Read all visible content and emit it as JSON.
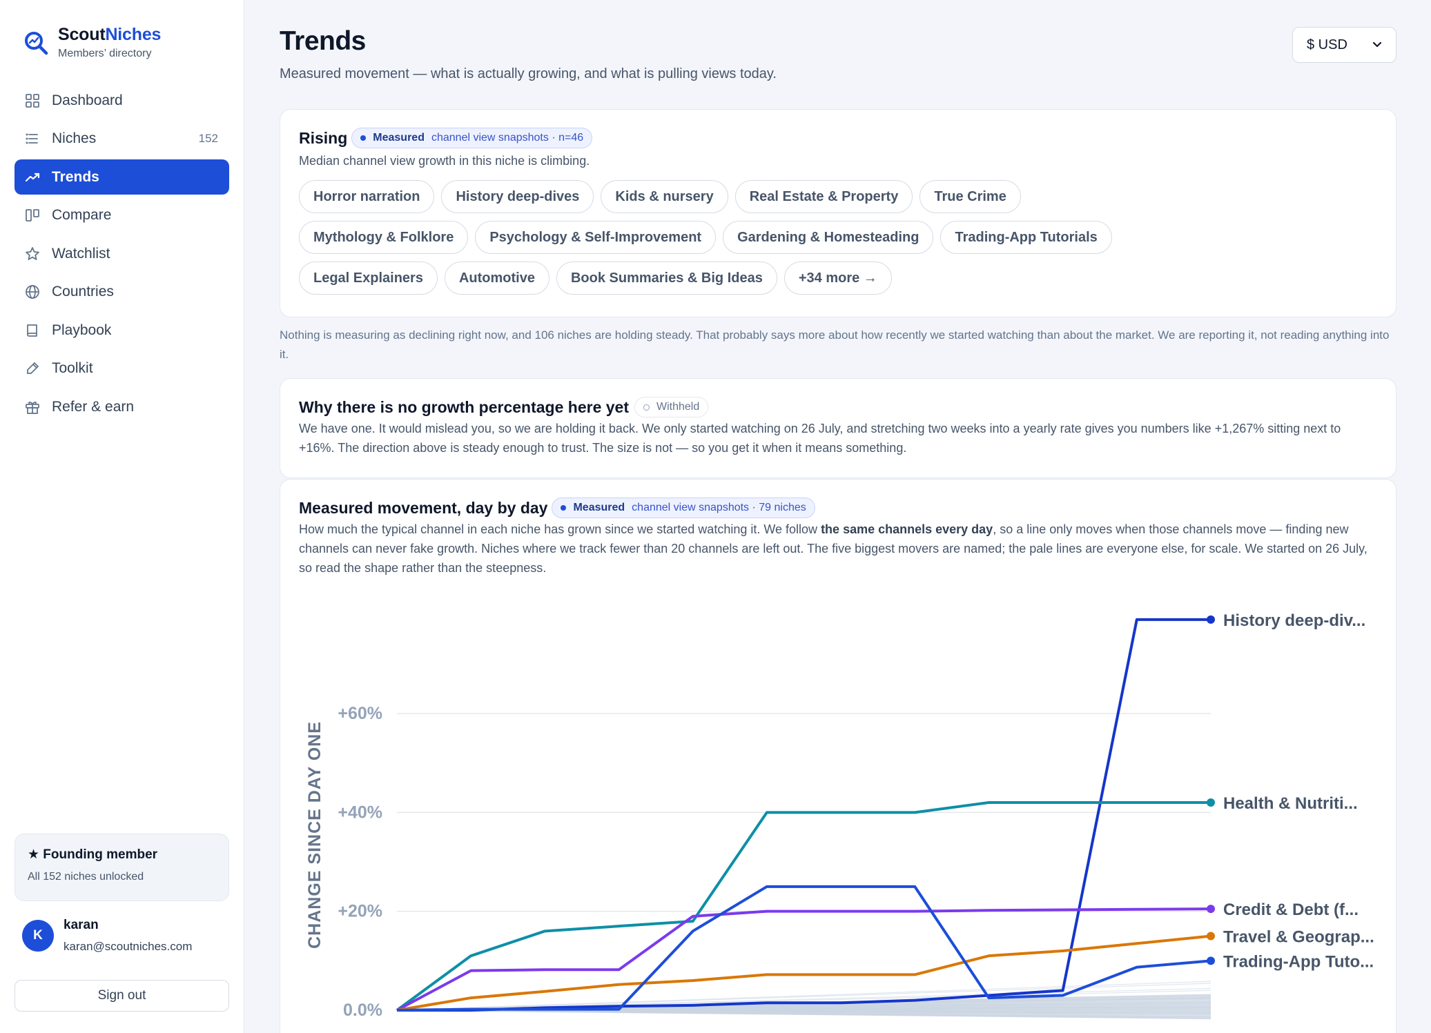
{
  "brand": {
    "name_a": "Scout",
    "name_b": "Niches",
    "subtitle": "Members’ directory"
  },
  "nav": [
    {
      "label": "Dashboard",
      "icon": "grid-icon",
      "count": ""
    },
    {
      "label": "Niches",
      "icon": "list-icon",
      "count": "152"
    },
    {
      "label": "Trends",
      "icon": "trend-icon",
      "count": "",
      "active": true
    },
    {
      "label": "Compare",
      "icon": "columns-icon",
      "count": ""
    },
    {
      "label": "Watchlist",
      "icon": "star-icon",
      "count": ""
    },
    {
      "label": "Countries",
      "icon": "globe-icon",
      "count": ""
    },
    {
      "label": "Playbook",
      "icon": "book-icon",
      "count": ""
    },
    {
      "label": "Toolkit",
      "icon": "tool-icon",
      "count": ""
    },
    {
      "label": "Refer & earn",
      "icon": "gift-icon",
      "count": ""
    }
  ],
  "founding": {
    "title": "★ Founding member",
    "subtitle": "All 152 niches unlocked"
  },
  "user": {
    "initial": "K",
    "name": "karan",
    "email": "karan@scoutniches.com"
  },
  "signout": "Sign out",
  "header": {
    "title": "Trends",
    "subtitle": "Measured movement — what is actually growing, and what is pulling views today.",
    "currency": "$ USD"
  },
  "rising": {
    "title": "Rising",
    "badge_strong": "Measured",
    "badge_text": "channel view snapshots · n=46",
    "description": "Median channel view growth in this niche is climbing.",
    "chips": [
      "Horror narration",
      "History deep-dives",
      "Kids & nursery",
      "Real Estate & Property",
      "True Crime",
      "Mythology & Folklore",
      "Psychology & Self-Improvement",
      "Gardening & Homesteading",
      "Trading-App Tutorials",
      "Legal Explainers",
      "Automotive",
      "Book Summaries & Big Ideas",
      "+34 more →"
    ]
  },
  "note": "Nothing is measuring as declining right now, and 106 niches are holding steady. That probably says more about how recently we started watching than about the market. We are reporting it, not reading anything into it.",
  "withheld": {
    "title": "Why there is no growth percentage here yet",
    "badge": "Withheld",
    "text": "We have one. It would mislead you, so we are holding it back. We only started watching on 26 July, and stretching two weeks into a yearly rate gives you numbers like +1,267% sitting next to +16%. The direction above is steady enough to trust. The size is not — so you get it when it means something."
  },
  "movement": {
    "title": "Measured movement, day by day",
    "badge_strong": "Measured",
    "badge_text": "channel view snapshots · 79 niches",
    "desc_a": "How much the typical channel in each niche has grown since we started watching it. We follow ",
    "desc_bold": "the same channels every day",
    "desc_b": ", so a line only moves when those channels move — finding new channels can never fake growth. Niches where we track fewer than 20 channels are left out. The five biggest movers are named; the pale lines are everyone else, for scale. We started on 26 July, so read the shape rather than the steepness."
  },
  "chart_data": {
    "type": "line",
    "ylabel": "CHANGE SINCE DAY ONE",
    "y_ticks": [
      "0.0%",
      "+20%",
      "+40%",
      "+60%"
    ],
    "y_tick_values": [
      0,
      20,
      40,
      60
    ],
    "ylim": [
      0,
      80
    ],
    "grid": true,
    "x": [
      0,
      1,
      2,
      3,
      4,
      5,
      6,
      7,
      8,
      9,
      10,
      11
    ],
    "series": [
      {
        "name": "History deep-div...",
        "color": "#1536c9",
        "values": [
          0,
          0,
          0.5,
          0.8,
          1,
          1.5,
          1.5,
          2,
          3,
          4,
          79,
          79
        ]
      },
      {
        "name": "Health & Nutriti...",
        "color": "#0e8fa6",
        "values": [
          0,
          11,
          16,
          17,
          18,
          40,
          40,
          40,
          42,
          42,
          42,
          42
        ]
      },
      {
        "name": "Credit & Debt (f...",
        "color": "#7c3aed",
        "values": [
          0,
          8,
          8.2,
          8.2,
          19,
          20,
          20,
          20,
          20.2,
          20.3,
          20.4,
          20.5
        ]
      },
      {
        "name": "Travel & Geograp...",
        "color": "#d97706",
        "values": [
          0,
          2.5,
          3.8,
          5.2,
          6,
          7.2,
          7.2,
          7.2,
          11,
          12,
          13.5,
          15
        ]
      },
      {
        "name": "Trading-App Tuto...",
        "color": "#1d4ed8",
        "values": [
          0,
          0.2,
          0.2,
          0.2,
          16,
          25,
          25,
          25,
          2.5,
          3,
          8.7,
          10
        ]
      }
    ],
    "background_series_count": 74
  }
}
